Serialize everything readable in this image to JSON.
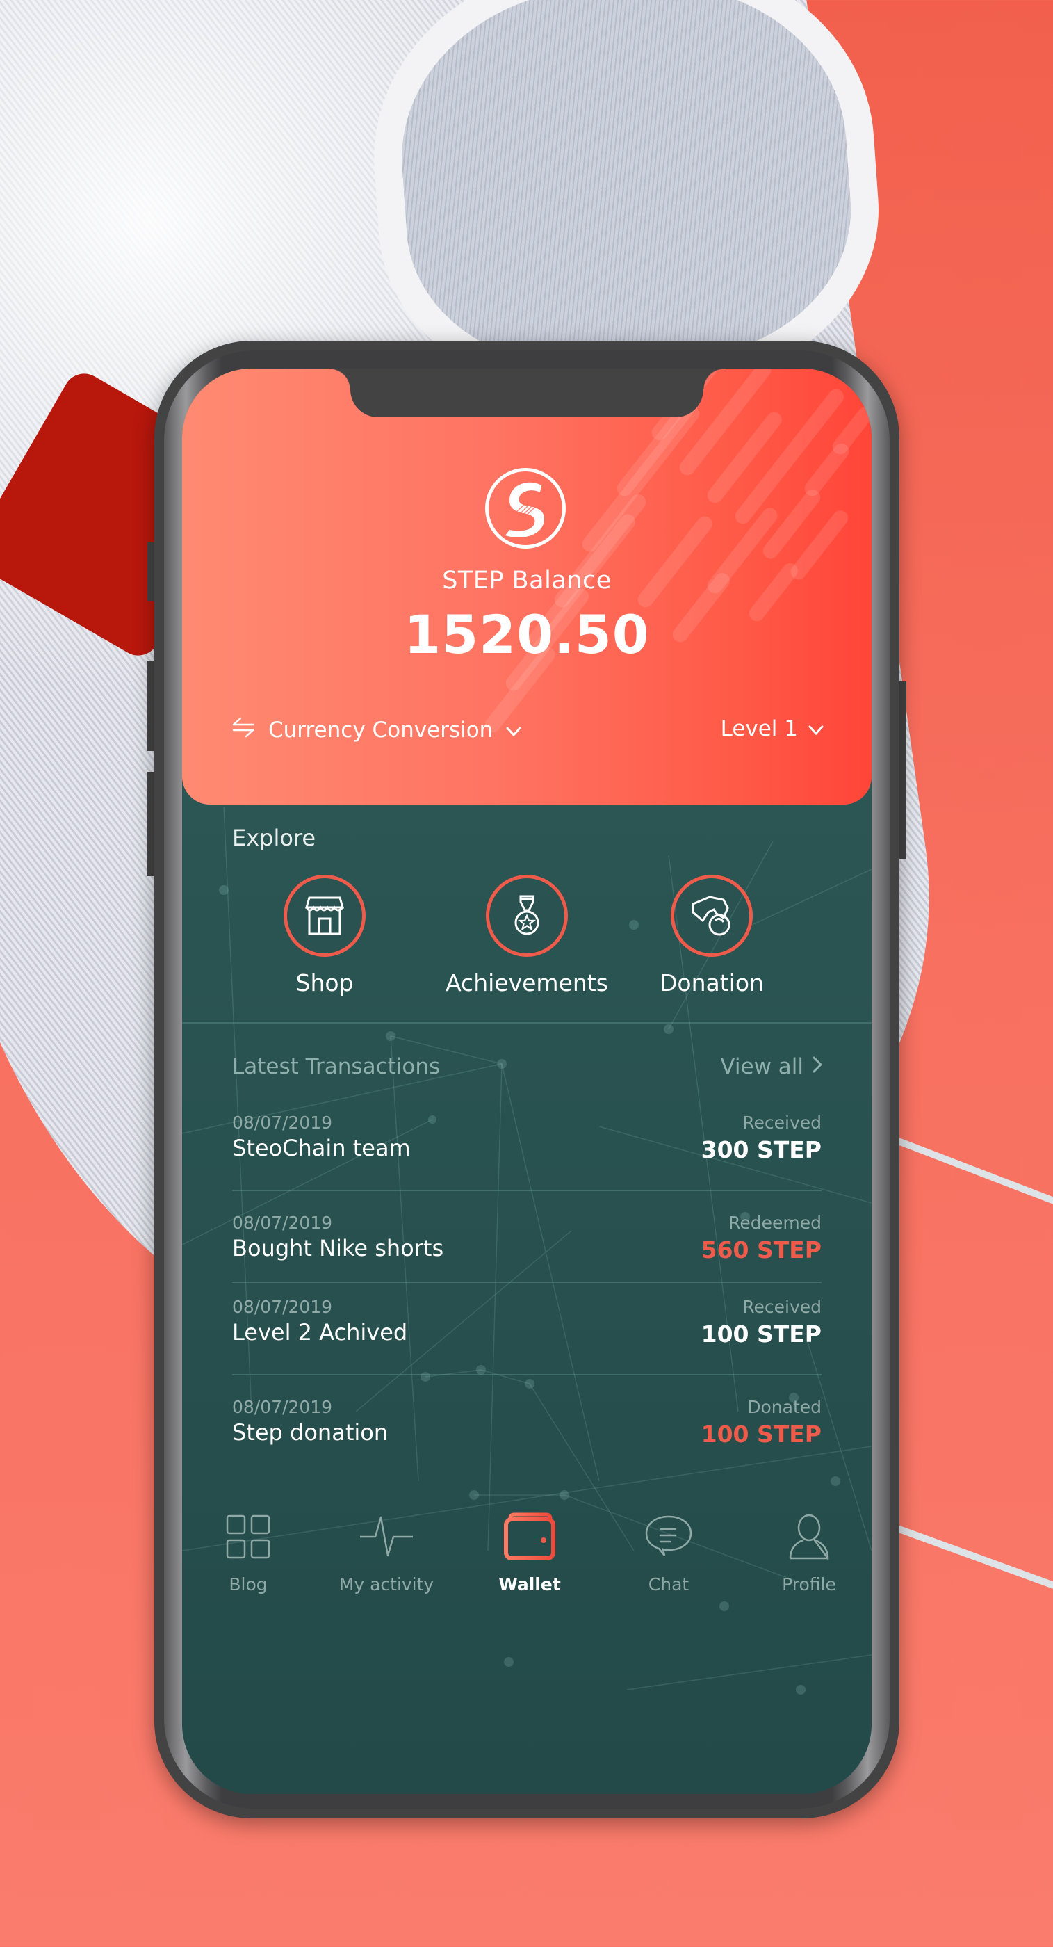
{
  "colors": {
    "accent": "#ef5b4b",
    "header_gradient_start": "#ff8a72",
    "header_gradient_end": "#ff4538",
    "screen_bg": "#2a5452",
    "received_amount": "#ffffff",
    "spent_amount": "#ef5b4b",
    "muted_text": "#8fa9a6"
  },
  "header": {
    "logo_icon": "stepchain-logo-icon",
    "balance_label": "STEP Balance",
    "balance_value": "1520.50",
    "currency_conversion": {
      "icon": "swap-arrows-icon",
      "label": "Currency Conversion",
      "chevron": "chevron-down-icon"
    },
    "level": {
      "label": "Level 1",
      "chevron": "chevron-down-icon"
    }
  },
  "explore": {
    "title": "Explore",
    "items": [
      {
        "label": "Shop",
        "icon": "storefront-icon"
      },
      {
        "label": "Achievements",
        "icon": "medal-icon"
      },
      {
        "label": "Donation",
        "icon": "hand-coin-icon"
      }
    ]
  },
  "transactions": {
    "title": "Latest Transactions",
    "view_all": "View all",
    "view_all_icon": "chevron-right-icon",
    "items": [
      {
        "date": "08/07/2019",
        "name": "SteoChain team",
        "type": "Received",
        "amount": "300 STEP",
        "kind": "in"
      },
      {
        "date": "08/07/2019",
        "name": "Bought Nike shorts",
        "type": "Redeemed",
        "amount": "560 STEP",
        "kind": "out"
      },
      {
        "date": "08/07/2019",
        "name": "Level 2 Achived",
        "type": "Received",
        "amount": "100 STEP",
        "kind": "in"
      },
      {
        "date": "08/07/2019",
        "name": "Step donation",
        "type": "Donated",
        "amount": "100 STEP",
        "kind": "out"
      }
    ]
  },
  "nav": {
    "active": "Wallet",
    "items": [
      {
        "label": "Blog",
        "icon": "grid-icon"
      },
      {
        "label": "My activity",
        "icon": "pulse-icon"
      },
      {
        "label": "Wallet",
        "icon": "wallet-icon"
      },
      {
        "label": "Chat",
        "icon": "chat-bubble-icon"
      },
      {
        "label": "Profile",
        "icon": "user-icon"
      }
    ]
  }
}
